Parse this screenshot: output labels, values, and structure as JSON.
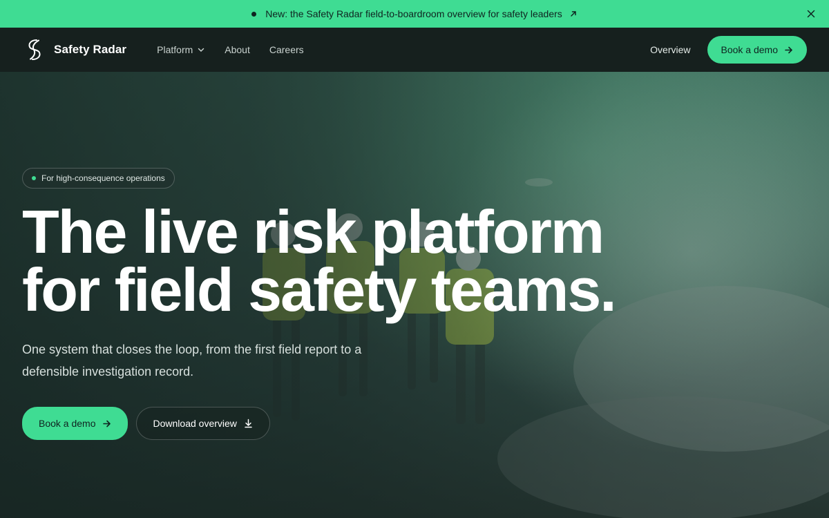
{
  "announcement": {
    "text": "New: the Safety Radar field-to-boardroom overview for safety leaders",
    "link_icon": "arrow-up-right-icon",
    "close_icon": "close-icon"
  },
  "nav": {
    "brand_name": "Safety Radar",
    "logo_icon": "safety-radar-logo-icon",
    "links": [
      {
        "label": "Platform",
        "has_dropdown": true
      },
      {
        "label": "About"
      },
      {
        "label": "Careers"
      }
    ],
    "overview_label": "Overview",
    "cta_label": "Book a demo"
  },
  "hero": {
    "eyebrow": "For high-consequence operations",
    "headline_line1": "The live risk platform",
    "headline_line2": "for field safety teams.",
    "subtext": "One system that closes the loop, from the first field report to a defensible investigation record.",
    "primary_cta": "Book a demo",
    "secondary_cta": "Download overview"
  },
  "colors": {
    "accent": "#3fdc93",
    "nav_bg": "#16201e",
    "text_dark": "#0f2420"
  }
}
